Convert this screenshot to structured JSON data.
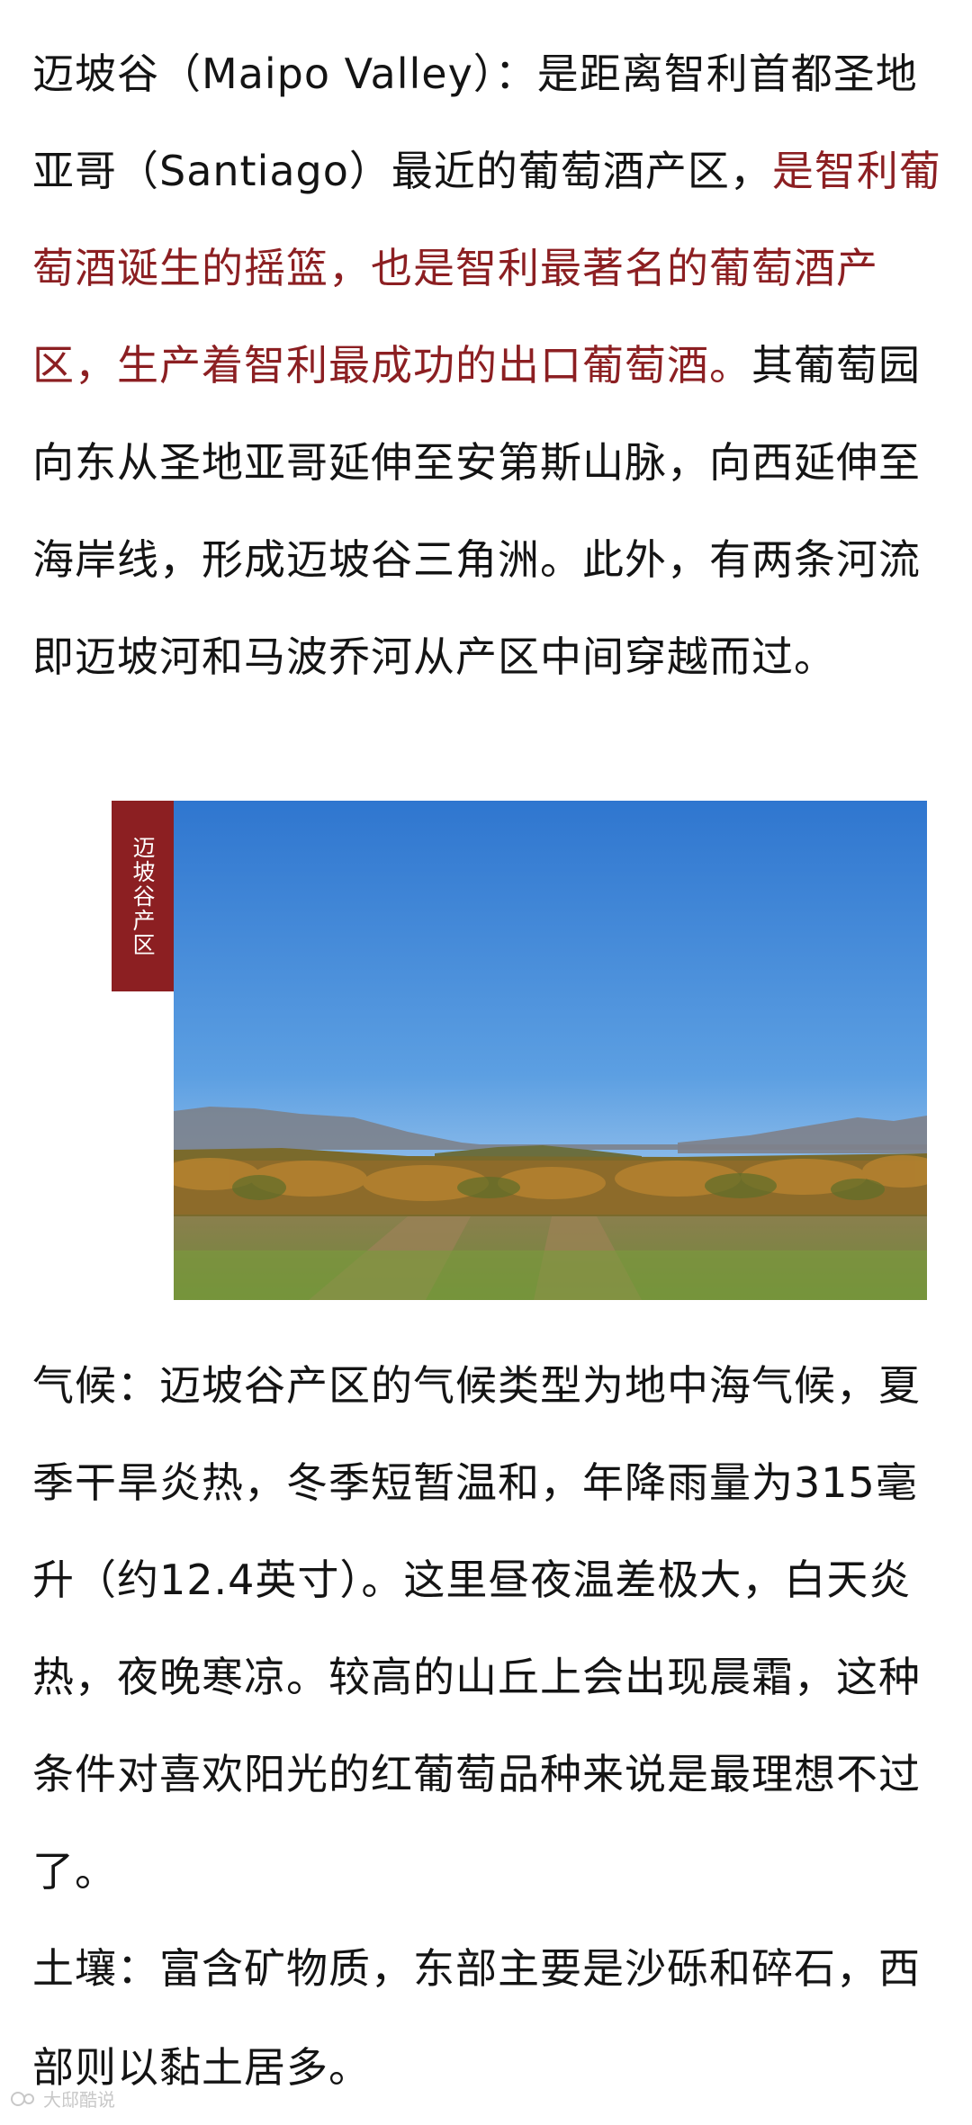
{
  "article": {
    "paragraph1": {
      "lead": "迈坡谷（Maipo Valley）：是距离智利首都圣地亚哥（Santiago）最近的葡萄酒产区，",
      "highlight": "是智利葡萄酒诞生的摇篮，也是智利最著名的葡萄酒产区，生产着智利最成功的出口葡萄酒。",
      "rest": "其葡萄园向东从圣地亚哥延伸至安第斯山脉，向西延伸至海岸线，形成迈坡谷三角洲。此外，有两条河流即迈坡河和马波乔河从产区中间穿越而过。"
    },
    "image_tag": "迈坡谷产区",
    "climate": {
      "label": "气候：",
      "text": "迈坡谷产区的气候类型为地中海气候，夏季干旱炎热，冬季短暂温和，年降雨量为315毫升（约12.4英寸）。这里昼夜温差极大，白天炎热，夜晚寒凉。较高的山丘上会出现晨霜，这种条件对喜欢阳光的红葡萄品种来说是最理想不过了。"
    },
    "soil": {
      "label": "土壤：",
      "text": "富含矿物质，东部主要是沙砾和碎石，西部则以黏土居多。"
    },
    "watermark": "大邸酷说"
  },
  "colors": {
    "accent": "#8c1f22",
    "text": "#141414"
  }
}
